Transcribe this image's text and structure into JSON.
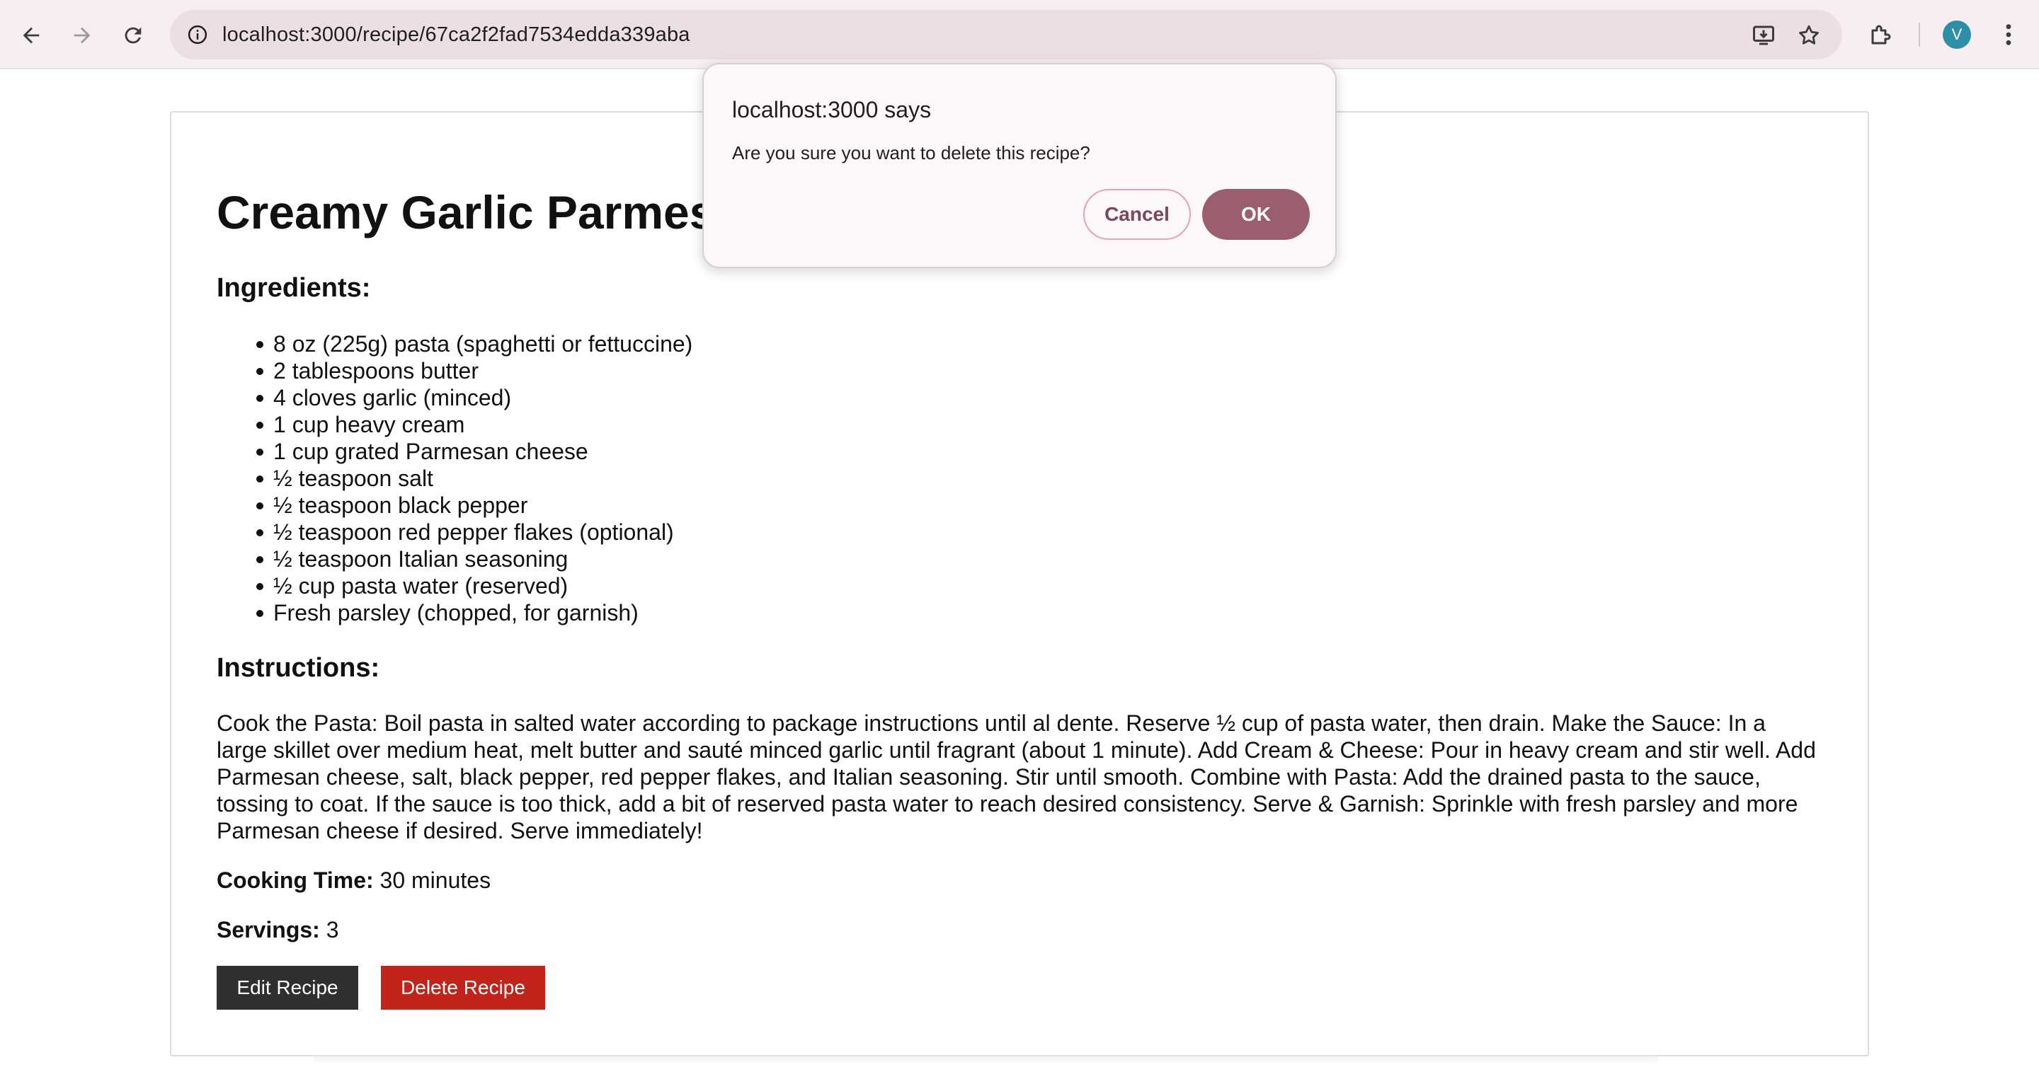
{
  "browser": {
    "url": "localhost:3000/recipe/67ca2f2fad7534edda339aba",
    "avatar_letter": "V",
    "icons": {
      "back": "arrow-left-icon",
      "forward": "arrow-right-icon",
      "reload": "reload-icon",
      "site_info": "info-icon",
      "install": "install-app-icon",
      "bookmark": "star-icon",
      "extensions": "puzzle-icon",
      "menu": "kebab-menu-icon"
    },
    "colors": {
      "chrome_bg": "#f6eef0",
      "omnibox_bg": "#ecdfe3",
      "avatar_bg": "#2c8ea7"
    }
  },
  "recipe": {
    "title": "Creamy Garlic Parmesan Pasta",
    "ingredients_heading": "Ingredients:",
    "ingredients": [
      "8 oz (225g) pasta (spaghetti or fettuccine)",
      "2 tablespoons butter",
      "4 cloves garlic (minced)",
      "1 cup heavy cream",
      "1 cup grated Parmesan cheese",
      "½ teaspoon salt",
      "½ teaspoon black pepper",
      "½ teaspoon red pepper flakes (optional)",
      "½ teaspoon Italian seasoning",
      "½ cup pasta water (reserved)",
      "Fresh parsley (chopped, for garnish)"
    ],
    "instructions_heading": "Instructions:",
    "instructions": "Cook the Pasta: Boil pasta in salted water according to package instructions until al dente. Reserve ½ cup of pasta water, then drain. Make the Sauce: In a large skillet over medium heat, melt butter and sauté minced garlic until fragrant (about 1 minute). Add Cream & Cheese: Pour in heavy cream and stir well. Add Parmesan cheese, salt, black pepper, red pepper flakes, and Italian seasoning. Stir until smooth. Combine with Pasta: Add the drained pasta to the sauce, tossing to coat. If the sauce is too thick, add a bit of reserved pasta water to reach desired consistency. Serve & Garnish: Sprinkle with fresh parsley and more Parmesan cheese if desired. Serve immediately!",
    "cooking_time_label": "Cooking Time:",
    "cooking_time_value": "30 minutes",
    "servings_label": "Servings:",
    "servings_value": "3",
    "edit_label": "Edit Recipe",
    "delete_label": "Delete Recipe",
    "colors": {
      "edit_button": "#2f2f2f",
      "delete_button": "#c2241c"
    }
  },
  "dialog": {
    "title": "localhost:3000 says",
    "message": "Are you sure you want to delete this recipe?",
    "cancel_label": "Cancel",
    "ok_label": "OK",
    "colors": {
      "ok_button": "#9b5e6e",
      "cancel_border": "#e8a2b5"
    }
  }
}
